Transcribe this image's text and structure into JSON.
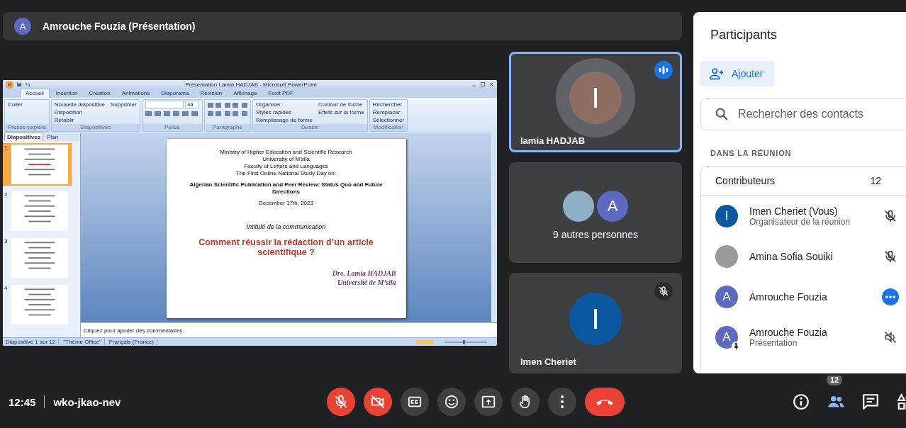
{
  "top_bar": {
    "avatar": "A",
    "title": "Amrouche Fouzia (Présentation)"
  },
  "shared_screen": {
    "window_title": "Présentation Lamia HADJAB - Microsoft PowerPoint",
    "ribbon_tabs": [
      {
        "label": "Accueil",
        "selected": true
      },
      {
        "label": "Insertion",
        "selected": false
      },
      {
        "label": "Création",
        "selected": false
      },
      {
        "label": "Animations",
        "selected": false
      },
      {
        "label": "Diaporama",
        "selected": false
      },
      {
        "label": "Révision",
        "selected": false
      },
      {
        "label": "Affichage",
        "selected": false
      },
      {
        "label": "Foxit PDF",
        "selected": false
      }
    ],
    "ribbon_groups": [
      {
        "kind": "buttons",
        "label": "Presse-papiers",
        "buttons": [
          "Coller"
        ]
      },
      {
        "kind": "buttons",
        "label": "Diapositives",
        "buttons": [
          "Nouvelle diapositive",
          "Disposition",
          "Rétablir",
          "Supprimer"
        ]
      },
      {
        "kind": "font",
        "label": "Police",
        "font_size": "44"
      },
      {
        "kind": "paragraph",
        "label": "Paragraphe"
      },
      {
        "kind": "buttons",
        "label": "Dessin",
        "buttons": [
          "Organiser",
          "Styles rapides",
          "Remplissage de forme",
          "Contour de forme",
          "Effets sur la forme"
        ]
      },
      {
        "kind": "buttons",
        "label": "Modification",
        "buttons": [
          "Rechercher",
          "Remplacer",
          "Sélectionner"
        ]
      }
    ],
    "pane_tabs": [
      {
        "label": "Diapositives",
        "selected": true
      },
      {
        "label": "Plan",
        "selected": false
      }
    ],
    "thumbnails": [
      {
        "number": "1",
        "selected": true
      },
      {
        "number": "2",
        "selected": false
      },
      {
        "number": "3",
        "selected": false
      },
      {
        "number": "4",
        "selected": false
      }
    ],
    "slide": {
      "header_lines": [
        "Ministry of Higher Education and Scientific Research",
        "University of M'sila",
        "Faculty of Letters and Languages",
        "The First Online National Study Day on:"
      ],
      "event_title": "Algerian Scientific Publication and Peer Review: Status Quo and Future Directions",
      "date": "December 17th, 2023",
      "subtitle": "Intitulé de la communication",
      "title": "Comment réussir la rédaction d’un article scientifique ?",
      "author": "Dre. Lamia HADJAB",
      "affiliation": "Université de M’sila"
    },
    "notes_placeholder": "Cliquez pour ajouter des commentaires",
    "status_bar": [
      "Diapositive 1 sur 12",
      "\"Thème Office\"",
      "Français (France)"
    ]
  },
  "tiles": [
    {
      "kind": "person",
      "name": "Iamia HADJAB",
      "avatar": "I",
      "color": "#8d6e63",
      "selected": true,
      "speaking": true,
      "muted": false
    },
    {
      "kind": "others",
      "label": "9 autres personnes",
      "avatar": "A",
      "color": "#5c6bc0"
    },
    {
      "kind": "person",
      "name": "Imen Cheriet",
      "avatar": "I",
      "color": "#0b57a0",
      "selected": false,
      "speaking": false,
      "muted": true
    }
  ],
  "panel": {
    "title": "Participants",
    "add_button": "Ajouter",
    "search_placeholder": "Rechercher des contacts",
    "section": "DANS LA RÉUNION",
    "group_label": "Contributeurs",
    "group_count": "12",
    "participants": [
      {
        "kind": "letter",
        "name": "Imen Cheriet (Vous)",
        "role": "Organisateur de la réunion",
        "avatar": "I",
        "color": "#0b57a0",
        "muted": true,
        "speaking": false,
        "presenting": false
      },
      {
        "kind": "photo",
        "name": "Amina Sofia Souiki",
        "muted": true,
        "speaking": false,
        "presenting": false
      },
      {
        "kind": "letter",
        "name": "Amrouche Fouzia",
        "avatar": "A",
        "color": "#5c6bc0",
        "muted": false,
        "speaking": true,
        "presenting": false
      },
      {
        "kind": "letter",
        "name": "Amrouche Fouzia",
        "role": "Présentation",
        "avatar": "A",
        "color": "#5c6bc0",
        "muted": true,
        "speaking": false,
        "presenting": true
      }
    ]
  },
  "bottom_bar": {
    "time": "12:45",
    "meeting_code": "wko-jkao-nev",
    "controls": [
      {
        "kind": "mic",
        "off": true
      },
      {
        "kind": "camera",
        "off": true
      },
      {
        "kind": "captions",
        "off": false
      },
      {
        "kind": "emoji",
        "off": false
      },
      {
        "kind": "present",
        "off": false
      },
      {
        "kind": "hand",
        "off": false
      },
      {
        "kind": "more",
        "off": false
      },
      {
        "kind": "hangup"
      }
    ],
    "side_buttons": [
      {
        "kind": "info",
        "selected": false
      },
      {
        "kind": "people",
        "selected": true,
        "badge": "12"
      },
      {
        "kind": "chat",
        "selected": false
      },
      {
        "kind": "activities",
        "selected": false
      }
    ]
  }
}
